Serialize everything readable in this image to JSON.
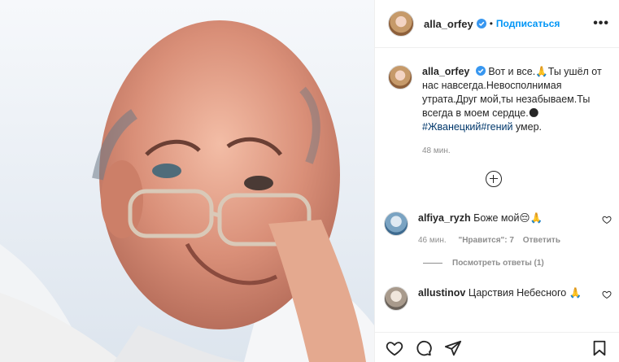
{
  "post": {
    "author": "alla_orfey",
    "follow_label": "Подписаться",
    "separator": "•",
    "more_label": "•••",
    "caption_text": "Вот и все.🙏Ты ушёл от нас навсегда.Невосполнимая утрата.Друг мой,ты незабываем.Ты всегда в моем сердце.🌑",
    "hashtags": "#Жванецкий#гений",
    "caption_tail": " умер.",
    "time": "48 мин."
  },
  "comments": [
    {
      "user": "alfiya_ryzh",
      "text": "Боже мой😔🙏",
      "time": "46 мин.",
      "likes_label": "\"Нравится\": 7",
      "reply": "Ответить"
    },
    {
      "user": "allustinov",
      "text": "Царствия Небесного 🙏"
    }
  ],
  "replies_label": "Посмотреть ответы (1)",
  "colors": {
    "accent": "#0095f6",
    "hashtag": "#00376b",
    "muted": "#8e8e8e"
  },
  "icons": [
    "verified-icon",
    "more-icon",
    "load-more-icon",
    "heart-icon",
    "comment-icon",
    "share-icon",
    "bookmark-icon"
  ]
}
